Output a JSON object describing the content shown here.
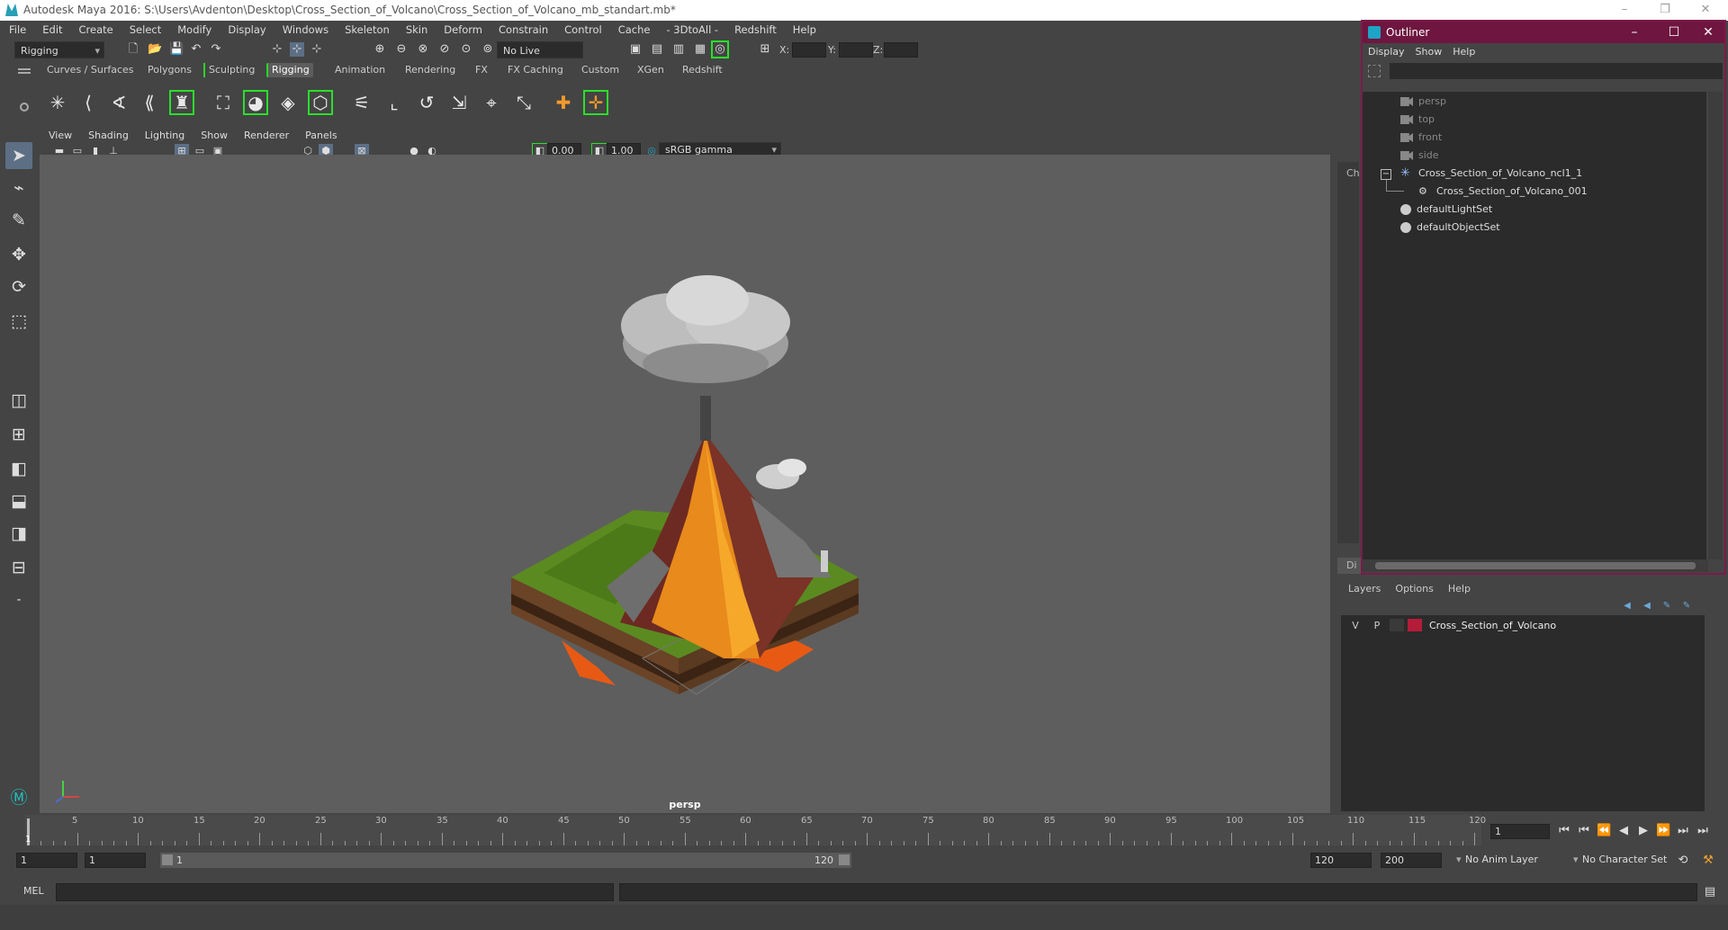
{
  "title_bar": {
    "title": "Autodesk Maya 2016: S:\\Users\\Avdenton\\Desktop\\Cross_Section_of_Volcano\\Cross_Section_of_Volcano_mb_standart.mb*"
  },
  "menubar": [
    "File",
    "Edit",
    "Create",
    "Select",
    "Modify",
    "Display",
    "Windows",
    "Skeleton",
    "Skin",
    "Deform",
    "Constrain",
    "Control",
    "Cache",
    "- 3DtoAll -",
    "Redshift",
    "Help"
  ],
  "status_line": {
    "mode": "Rigging",
    "live_surface": "No Live Surface",
    "x_label": "X:",
    "y_label": "Y:",
    "z_label": "Z:"
  },
  "shelf_tabs": [
    "Curves / Surfaces",
    "Polygons",
    "Sculpting",
    "Rigging",
    "Animation",
    "Rendering",
    "FX",
    "FX Caching",
    "Custom",
    "XGen",
    "Redshift"
  ],
  "shelf_active": "Rigging",
  "viewport_menu": [
    "View",
    "Shading",
    "Lighting",
    "Show",
    "Renderer",
    "Panels"
  ],
  "viewport_tools": {
    "exposure": "0.00",
    "gamma": "1.00",
    "color_space": "sRGB gamma"
  },
  "viewport": {
    "camera_label": "persp"
  },
  "dock_tabs": {
    "channel": "Ch",
    "display": "Di"
  },
  "outliner": {
    "title": "Outliner",
    "menu": [
      "Display",
      "Show",
      "Help"
    ],
    "items": [
      {
        "label": "persp",
        "dim": true,
        "indent": 0
      },
      {
        "label": "top",
        "dim": true,
        "indent": 0
      },
      {
        "label": "front",
        "dim": true,
        "indent": 0
      },
      {
        "label": "side",
        "dim": true,
        "indent": 0
      },
      {
        "label": "Cross_Section_of_Volcano_ncl1_1",
        "dim": false,
        "indent": 0
      },
      {
        "label": "Cross_Section_of_Volcano_001",
        "dim": false,
        "indent": 1
      },
      {
        "label": "defaultLightSet",
        "dim": false,
        "indent": 0
      },
      {
        "label": "defaultObjectSet",
        "dim": false,
        "indent": 0
      }
    ]
  },
  "layers": {
    "menu": [
      "Layers",
      "Options",
      "Help"
    ],
    "rows": [
      {
        "v": "V",
        "p": "P",
        "name": "Cross_Section_of_Volcano",
        "color": "#b51c3a"
      }
    ]
  },
  "timeline": {
    "ticks": [
      "5",
      "10",
      "15",
      "20",
      "25",
      "30",
      "35",
      "40",
      "45",
      "50",
      "55",
      "60",
      "65",
      "70",
      "75",
      "80",
      "85",
      "90",
      "95",
      "100",
      "105",
      "110",
      "115",
      "120"
    ],
    "current_frame": "1",
    "current_field": "1"
  },
  "range": {
    "start": "1",
    "anim_start": "1",
    "slider_start": "1",
    "slider_end": "120",
    "end": "120",
    "anim_end": "200",
    "anim_layer": "No Anim Layer",
    "character_set": "No Character Set"
  },
  "cmd": {
    "label": "MEL"
  }
}
